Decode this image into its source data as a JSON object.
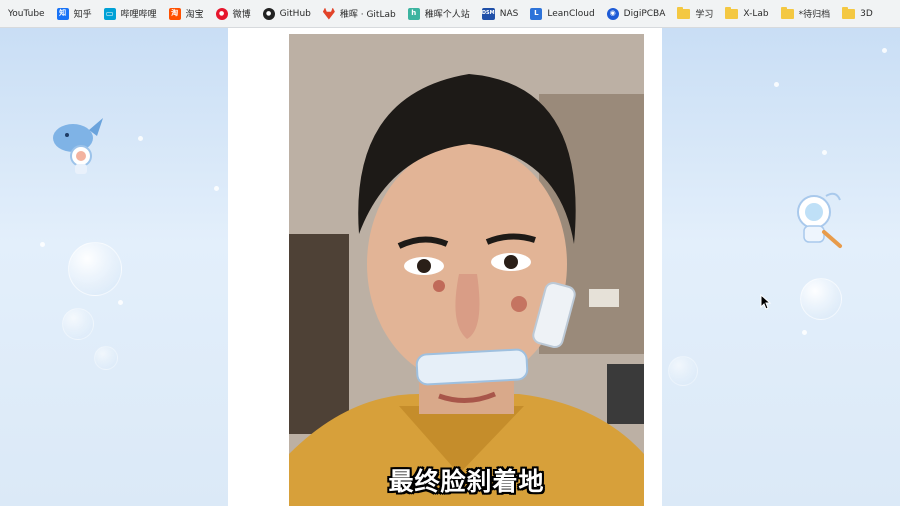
{
  "bookmarks": [
    {
      "label": "YouTube",
      "icon": "none"
    },
    {
      "label": "知乎",
      "icon": "zhihu-icon",
      "color": "#1772f6",
      "glyph": "知"
    },
    {
      "label": "哔哩哔哩",
      "icon": "bilibili-icon",
      "color": "#00a1d6",
      "glyph": "▭"
    },
    {
      "label": "淘宝",
      "icon": "taobao-icon",
      "color": "#ff5000",
      "glyph": "淘"
    },
    {
      "label": "微博",
      "icon": "weibo-icon",
      "color": "#e6162d",
      "glyph": "●"
    },
    {
      "label": "GitHub",
      "icon": "github-icon",
      "color": "#222222",
      "glyph": "●"
    },
    {
      "label": "稚晖 · GitLab",
      "icon": "gitlab-icon",
      "color": "#e24329",
      "glyph": ""
    },
    {
      "label": "稚晖个人站",
      "icon": "site-icon",
      "color": "#3cb4a0",
      "glyph": "h"
    },
    {
      "label": "NAS",
      "icon": "nas-icon",
      "color": "#1f4fa8",
      "glyph": "DSM"
    },
    {
      "label": "LeanCloud",
      "icon": "leancloud-icon",
      "color": "#2d73d9",
      "glyph": "L"
    },
    {
      "label": "DigiPCBA",
      "icon": "digipcba-icon",
      "color": "#1e5bd6",
      "glyph": "◉"
    },
    {
      "label": "学习",
      "icon": "folder-icon"
    },
    {
      "label": "X-Lab",
      "icon": "folder-icon"
    },
    {
      "label": "*待归档",
      "icon": "folder-icon"
    },
    {
      "label": "3D",
      "icon": "folder-icon"
    }
  ],
  "video": {
    "caption": "最终脸刹着地"
  },
  "colors": {
    "page_bg": "#ffffff",
    "side_bg": "#dfeefb",
    "folder": "#f4c842"
  }
}
